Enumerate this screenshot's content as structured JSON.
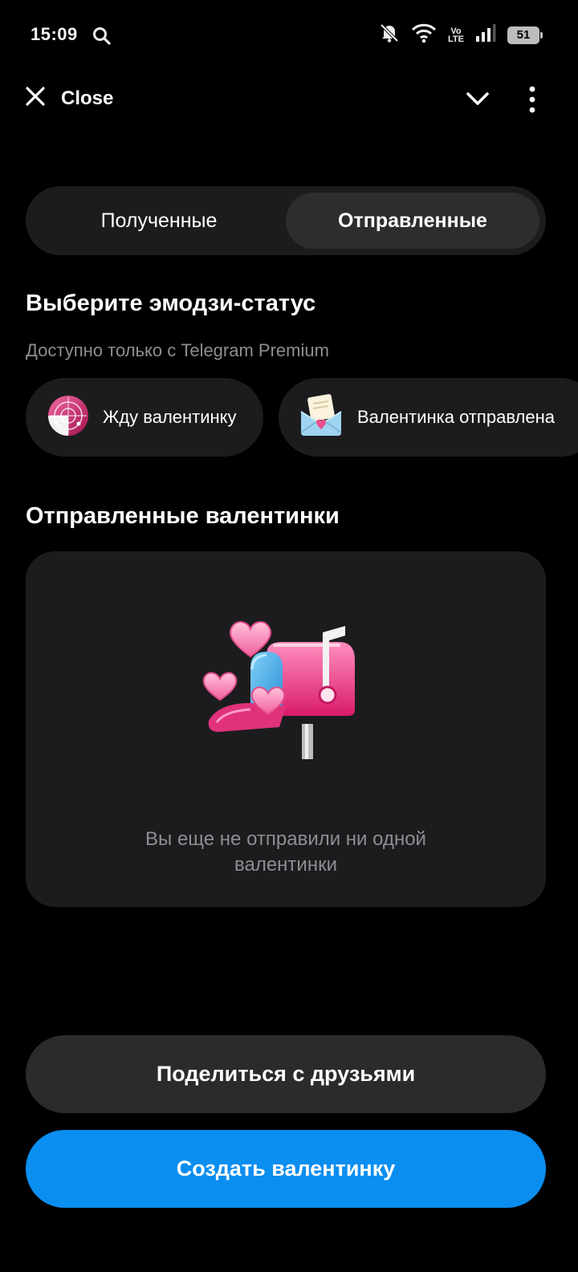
{
  "status_bar": {
    "time": "15:09",
    "volte_top": "Vo",
    "volte_bottom": "LTE",
    "battery": "51",
    "icons": [
      "search-icon",
      "bell-off-icon",
      "wifi-icon",
      "volte-icon",
      "signal-icon",
      "battery-icon"
    ]
  },
  "header": {
    "close_label": "Close",
    "icons": [
      "close-icon",
      "chevron-down-icon",
      "more-vertical-icon"
    ]
  },
  "tabs": [
    {
      "label": "Полученные",
      "selected": false
    },
    {
      "label": "Отправленные",
      "selected": true
    }
  ],
  "emoji_status": {
    "title": "Выберите эмодзи-статус",
    "subtitle": "Доступно только с Telegram Premium",
    "options": [
      {
        "label": "Жду валентинку",
        "icon": "radar-icon"
      },
      {
        "label": "Валентинка отправлена",
        "icon": "envelope-heart-icon"
      }
    ]
  },
  "sent_section": {
    "title": "Отправленные валентинки",
    "empty_text_line1": "Вы еще не отправили ни одной",
    "empty_text_line2": "валентинки",
    "illustration": "mailbox-hearts-icon"
  },
  "buttons": {
    "share": "Поделиться с друзьями",
    "create": "Создать валентинку"
  },
  "colors": {
    "background": "#000000",
    "card": "#1c1c1e",
    "accent": "#0a8ef0",
    "muted_text": "#8e8e93",
    "pink": "#ec4f8d"
  }
}
